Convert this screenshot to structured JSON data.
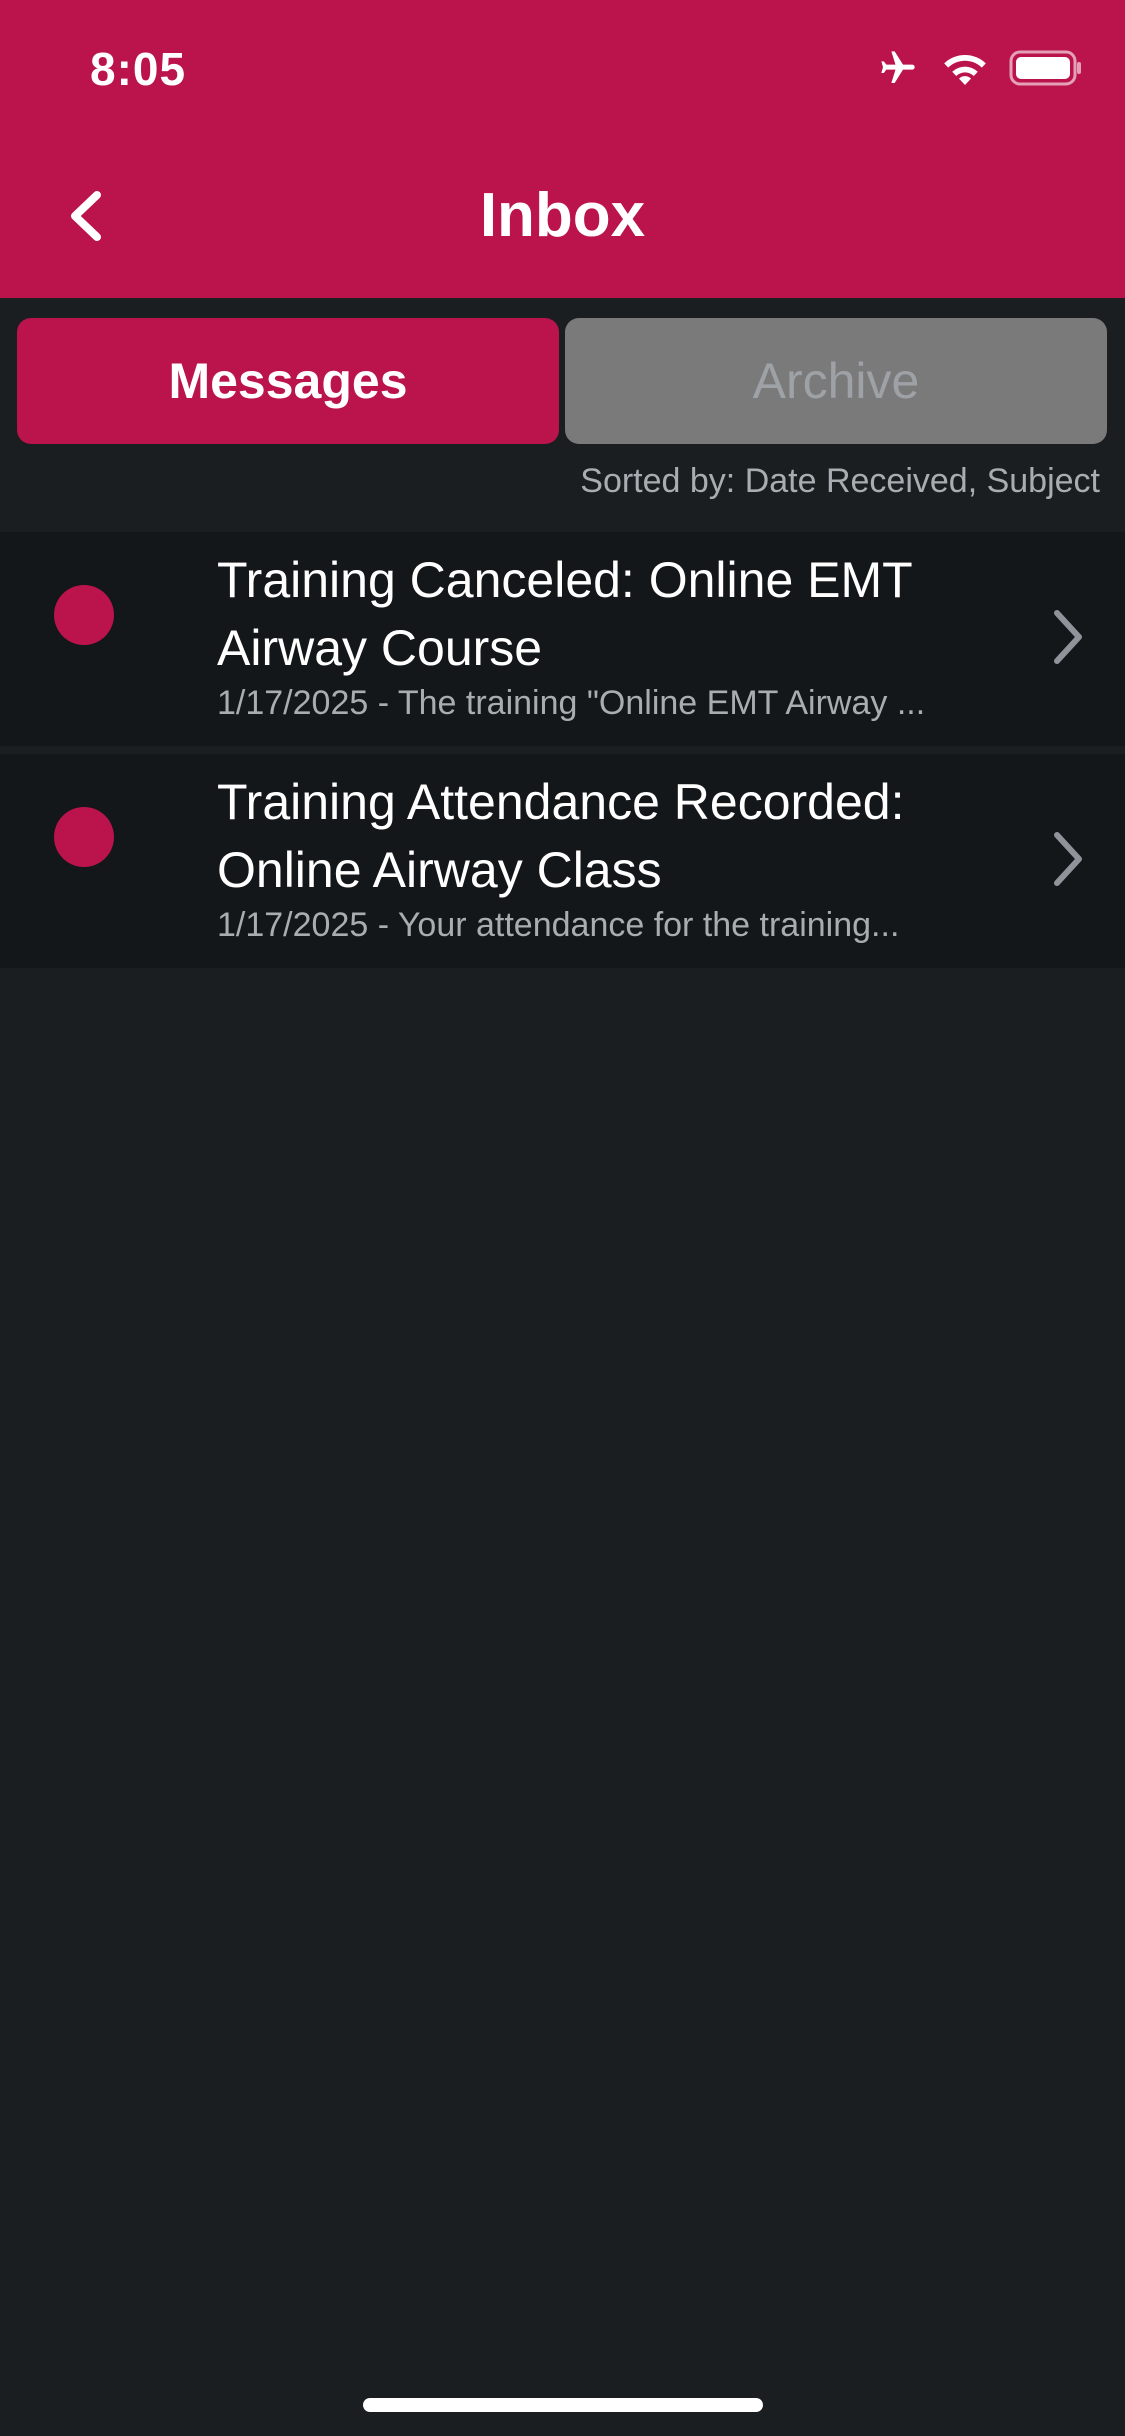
{
  "status_bar": {
    "time": "8:05",
    "icons": [
      "airplane-icon",
      "wifi-icon",
      "battery-icon"
    ]
  },
  "header": {
    "title": "Inbox",
    "back_icon": "chevron-left-icon"
  },
  "tabs": [
    {
      "label": "Messages",
      "active": true
    },
    {
      "label": "Archive",
      "active": false
    }
  ],
  "sort_label": "Sorted by: Date Received, Subject",
  "messages": [
    {
      "unread": true,
      "title": "Training Canceled: Online EMT Airway Course",
      "preview": "1/17/2025 - The training \"Online EMT Airway ..."
    },
    {
      "unread": true,
      "title": "Training Attendance Recorded: Online Airway Class",
      "preview": "1/17/2025 - Your attendance for the training..."
    }
  ],
  "colors": {
    "brand": "#bb134b",
    "background": "#1b1e21",
    "row_background": "#141719",
    "inactive_tab": "#7a7a7a",
    "muted_text": "#a8adb2"
  }
}
